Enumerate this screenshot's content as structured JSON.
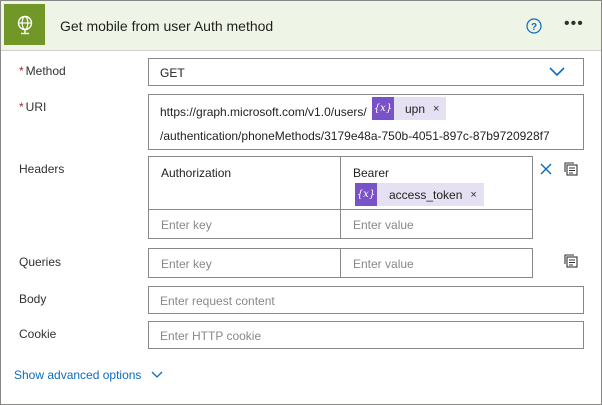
{
  "header": {
    "title": "Get mobile from user Auth method",
    "icon": "globe-icon",
    "accent": "#709727"
  },
  "fields": {
    "method": {
      "label": "Method",
      "required_mark": "*",
      "value": "GET"
    },
    "uri": {
      "label": "URI",
      "required_mark": "*",
      "line1_prefix": "https://graph.microsoft.com/v1.0/users/",
      "token_label": "upn",
      "token_remove": "×",
      "line2": "/authentication/phoneMethods/3179e48a-750b-4051-897c-87b9720928f7"
    },
    "headers": {
      "label": "Headers",
      "row1_key": "Authorization",
      "row1_value": "Bearer",
      "token_label": "access_token",
      "token_remove": "×",
      "key_placeholder": "Enter key",
      "value_placeholder": "Enter value"
    },
    "queries": {
      "label": "Queries",
      "key_placeholder": "Enter key",
      "value_placeholder": "Enter value"
    },
    "body": {
      "label": "Body",
      "placeholder": "Enter request content"
    },
    "cookie": {
      "label": "Cookie",
      "placeholder": "Enter HTTP cookie"
    }
  },
  "footer": {
    "advanced_label": "Show advanced options"
  },
  "colors": {
    "token_icon": "#7a52c7",
    "token_bg": "#e6e0f3",
    "link": "#0f6cbd",
    "required": "#a4262c"
  }
}
